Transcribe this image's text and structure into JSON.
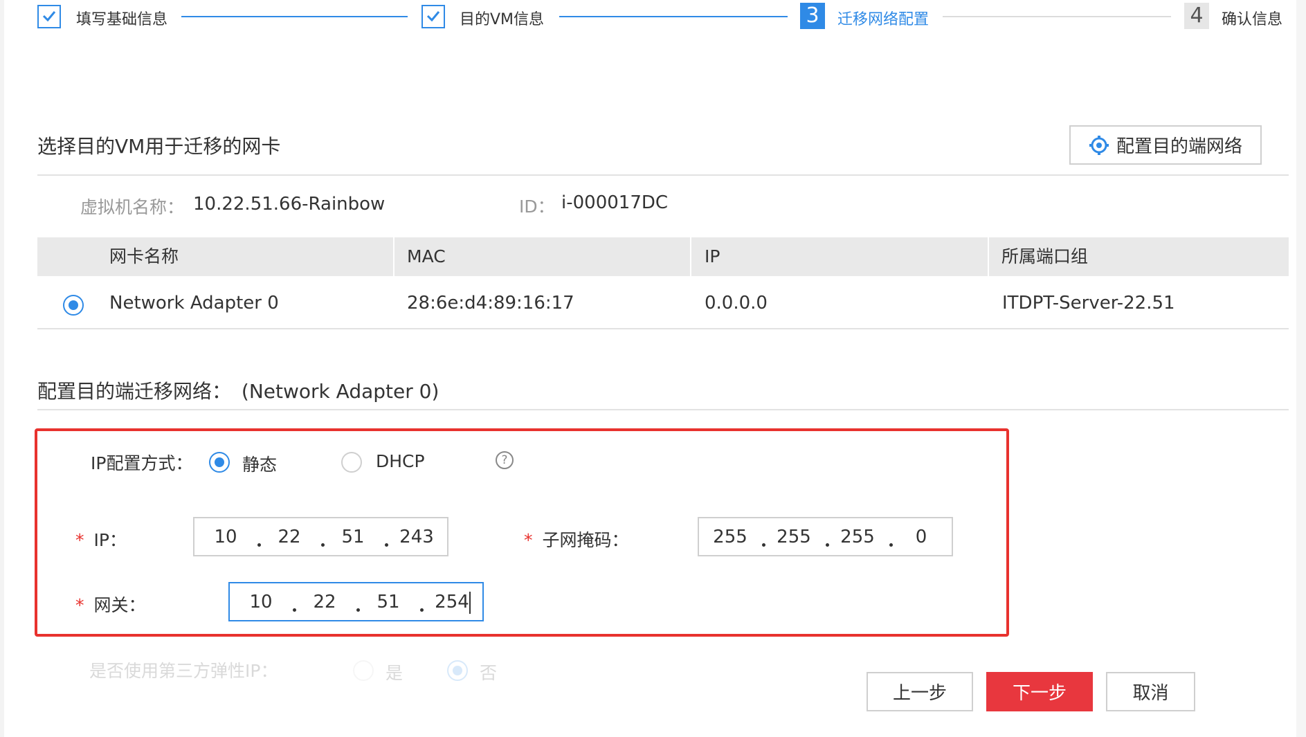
{
  "steps": [
    {
      "label": "填写基础信息",
      "state": "done"
    },
    {
      "label": "目的VM信息",
      "state": "done"
    },
    {
      "number": "3",
      "label": "迁移网络配置",
      "state": "active"
    },
    {
      "number": "4",
      "label": "确认信息",
      "state": "pending"
    }
  ],
  "nic_section": {
    "title": "选择目的VM用于迁移的网卡",
    "config_button": "配置目的端网络",
    "vm_name_label": "虚拟机名称：",
    "vm_name": "10.22.51.66-Rainbow",
    "id_label": "ID：",
    "id_value": "i-000017DC"
  },
  "table": {
    "headers": [
      "网卡名称",
      "MAC",
      "IP",
      "所属端口组"
    ],
    "rows": [
      {
        "selected": true,
        "name": "Network Adapter 0",
        "mac": "28:6e:d4:89:16:17",
        "ip": "0.0.0.0",
        "port_group": "ITDPT-Server-22.51"
      }
    ]
  },
  "network_section": {
    "title": "配置目的端迁移网络：",
    "adapter": "(Network Adapter 0)",
    "ip_mode_label": "IP配置方式：",
    "ip_mode_options": [
      {
        "label": "静态",
        "selected": true
      },
      {
        "label": "DHCP",
        "selected": false
      }
    ],
    "ip_label": "IP：",
    "ip": [
      "10",
      "22",
      "51",
      "243"
    ],
    "mask_label": "子网掩码：",
    "mask": [
      "255",
      "255",
      "255",
      "0"
    ],
    "gateway_label": "网关：",
    "gateway": [
      "10",
      "22",
      "51",
      "254"
    ],
    "required_mark": "*"
  },
  "faded_row": {
    "label": "是否使用第三方弹性IP：",
    "options": [
      {
        "label": "是",
        "selected": false
      },
      {
        "label": "否",
        "selected": true
      }
    ]
  },
  "footer": {
    "prev": "上一步",
    "next": "下一步",
    "cancel": "取消"
  },
  "colors": {
    "accent": "#2f8ae6",
    "danger": "#e8322e",
    "primary_button": "#e8373e"
  }
}
